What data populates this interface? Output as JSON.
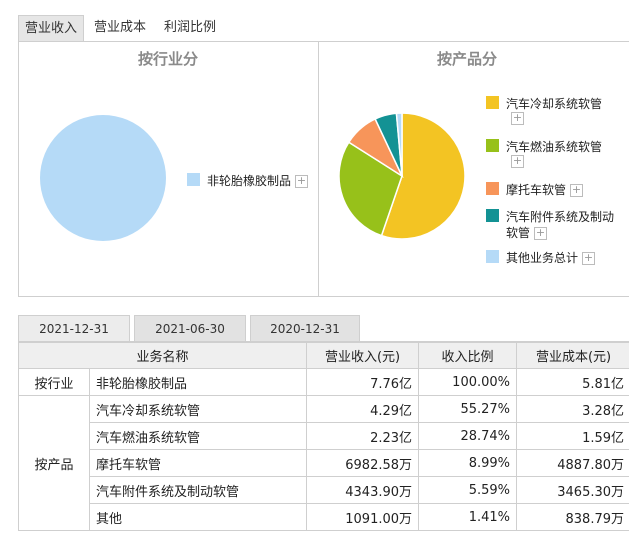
{
  "top_tabs": [
    "营业收入",
    "营业成本",
    "利润比例"
  ],
  "panels": {
    "industry": {
      "title": "按行业分",
      "legend": [
        {
          "label": "非轮胎橡胶制品",
          "color": "#b5daf7"
        }
      ]
    },
    "product": {
      "title": "按产品分",
      "legend": [
        {
          "label": "汽车冷却系统软管",
          "color": "#f3c423"
        },
        {
          "label": "汽车燃油系统软管",
          "color": "#97c11a"
        },
        {
          "label": "摩托车软管",
          "color": "#f7955a"
        },
        {
          "label": "汽车附件系统及制动",
          "label2": "软管",
          "color": "#139294"
        },
        {
          "label": "其他业务总计",
          "color": "#b5daf7"
        }
      ]
    }
  },
  "plus_symbol": "+",
  "chart_data": [
    {
      "type": "pie",
      "title": "按行业分",
      "categories": [
        "非轮胎橡胶制品"
      ],
      "values": [
        100.0
      ]
    },
    {
      "type": "pie",
      "title": "按产品分",
      "categories": [
        "汽车冷却系统软管",
        "汽车燃油系统软管",
        "摩托车软管",
        "汽车附件系统及制动软管",
        "其他业务总计"
      ],
      "values": [
        55.27,
        28.74,
        8.99,
        5.59,
        1.41
      ]
    }
  ],
  "date_tabs": [
    "2021-12-31",
    "2021-06-30",
    "2020-12-31"
  ],
  "table": {
    "headers": [
      "业务名称",
      "营业收入(元)",
      "收入比例",
      "营业成本(元)"
    ],
    "industry_label": "按行业",
    "product_label": "按产品",
    "industry_rows": [
      [
        "非轮胎橡胶制品",
        "7.76亿",
        "100.00%",
        "5.81亿"
      ]
    ],
    "product_rows": [
      [
        "汽车冷却系统软管",
        "4.29亿",
        "55.27%",
        "3.28亿"
      ],
      [
        "汽车燃油系统软管",
        "2.23亿",
        "28.74%",
        "1.59亿"
      ],
      [
        "摩托车软管",
        "6982.58万",
        "8.99%",
        "4887.80万"
      ],
      [
        "汽车附件系统及制动软管",
        "4343.90万",
        "5.59%",
        "3465.30万"
      ],
      [
        "其他",
        "1091.00万",
        "1.41%",
        "838.79万"
      ]
    ]
  }
}
